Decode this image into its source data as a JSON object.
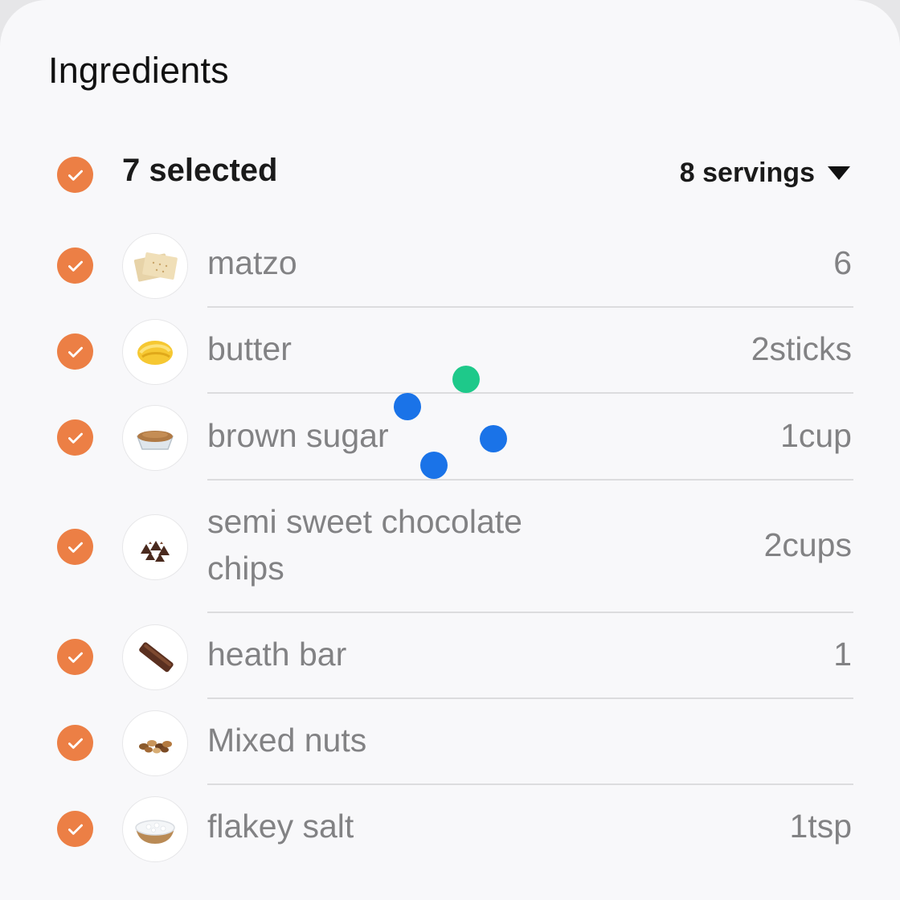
{
  "title": "Ingredients",
  "selection": {
    "count_label": "7 selected",
    "servings_label": "8 servings"
  },
  "colors": {
    "accent": "#ec7f45",
    "text_muted": "#828284",
    "dot_blue": "#1a73e8",
    "dot_green": "#1ec98a"
  },
  "ingredients": [
    {
      "name": "matzo",
      "quantity": "6",
      "icon": "matzo-icon",
      "checked": true
    },
    {
      "name": "butter",
      "quantity": "2sticks",
      "icon": "butter-icon",
      "checked": true
    },
    {
      "name": "brown sugar",
      "quantity": "1cup",
      "icon": "brown-sugar-icon",
      "checked": true
    },
    {
      "name": "semi sweet chocolate chips",
      "quantity": "2cups",
      "icon": "chocolate-chips-icon",
      "checked": true
    },
    {
      "name": "heath bar",
      "quantity": "1",
      "icon": "heath-bar-icon",
      "checked": true
    },
    {
      "name": "Mixed nuts",
      "quantity": "",
      "icon": "mixed-nuts-icon",
      "checked": true
    },
    {
      "name": "flakey salt",
      "quantity": "1tsp",
      "icon": "flakey-salt-icon",
      "checked": true
    }
  ]
}
